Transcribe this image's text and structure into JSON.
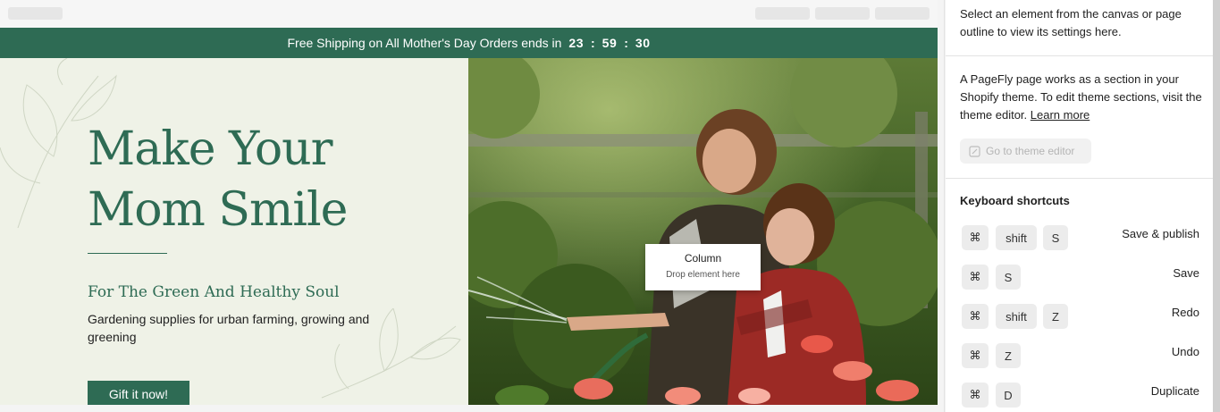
{
  "banner": {
    "text": "Free Shipping on All Mother's Day Orders ends in",
    "hours": "23",
    "minutes": "59",
    "seconds": "30",
    "separator": ":"
  },
  "hero": {
    "title_line1": "Make Your",
    "title_line2": "Mom Smile",
    "subtitle": "For The Green And Healthy Soul",
    "description": "Gardening supplies for urban farming, growing and greening",
    "cta": "Gift it now!"
  },
  "canvas_tooltip": {
    "title": "Column",
    "hint": "Drop element here"
  },
  "panel": {
    "intro": "Select an element from the canvas or page outline to view its settings here.",
    "theme_text": "A PageFly page works as a section in your Shopify theme. To edit theme sections, visit the theme editor.",
    "learn_more": "Learn more",
    "theme_button": "Go to theme editor",
    "shortcuts_title": "Keyboard shortcuts",
    "shortcuts": [
      {
        "keys": [
          "⌘",
          "shift",
          "S"
        ],
        "label": "Save & publish"
      },
      {
        "keys": [
          "⌘",
          "S"
        ],
        "label": "Save"
      },
      {
        "keys": [
          "⌘",
          "shift",
          "Z"
        ],
        "label": "Redo"
      },
      {
        "keys": [
          "⌘",
          "Z"
        ],
        "label": "Undo"
      },
      {
        "keys": [
          "⌘",
          "D"
        ],
        "label": "Duplicate"
      }
    ]
  },
  "colors": {
    "brand_green": "#2e6b54",
    "hero_bg": "#eff2e7"
  }
}
